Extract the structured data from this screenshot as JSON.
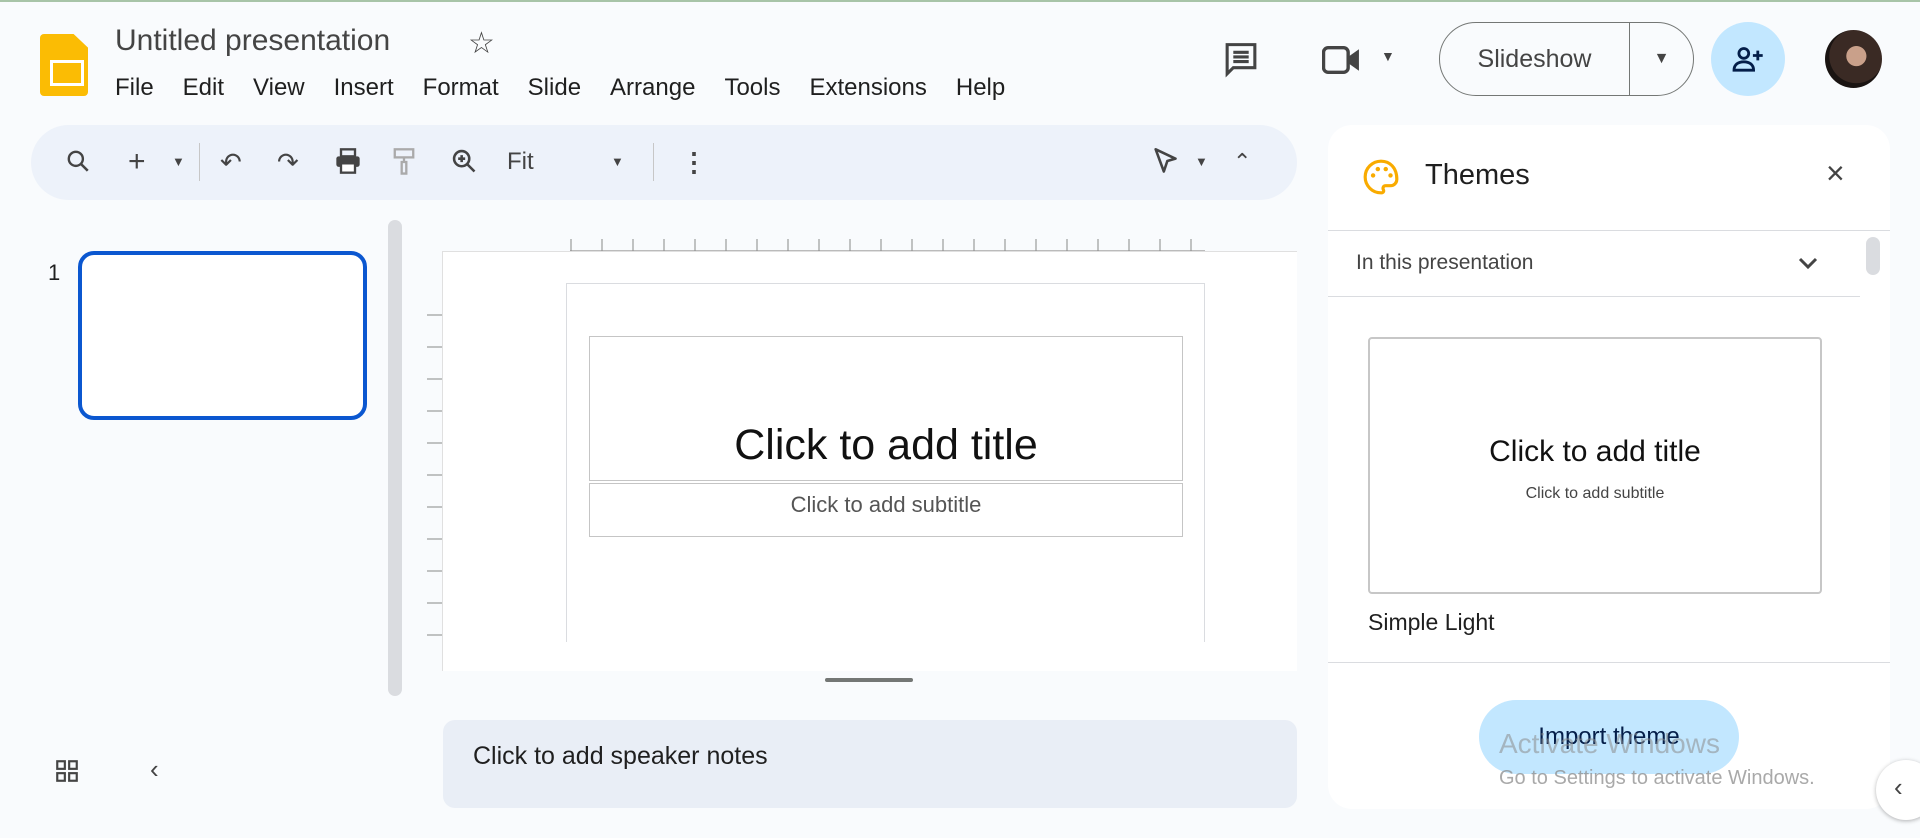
{
  "document": {
    "title": "Untitled presentation"
  },
  "menu": [
    "File",
    "Edit",
    "View",
    "Insert",
    "Format",
    "Slide",
    "Arrange",
    "Tools",
    "Extensions",
    "Help"
  ],
  "toolbar": {
    "zoom_value": "Fit"
  },
  "header": {
    "slideshow_label": "Slideshow"
  },
  "filmstrip": {
    "slide_number": "1"
  },
  "slide": {
    "title_placeholder": "Click to add title",
    "subtitle_placeholder": "Click to add subtitle"
  },
  "notes": {
    "placeholder": "Click to add speaker notes"
  },
  "themes": {
    "title": "Themes",
    "section": "In this presentation",
    "preview_title": "Click to add title",
    "preview_subtitle": "Click to add subtitle",
    "theme_name": "Simple Light",
    "import_label": "Import theme"
  },
  "watermark": {
    "line1": "Activate Windows",
    "line2": "Go to Settings to activate Windows."
  },
  "colors": {
    "accent": "#0b57d0",
    "share_bg": "#c2e7ff",
    "logo": "#fbbc04",
    "panel_icon": "#f9ab00"
  }
}
